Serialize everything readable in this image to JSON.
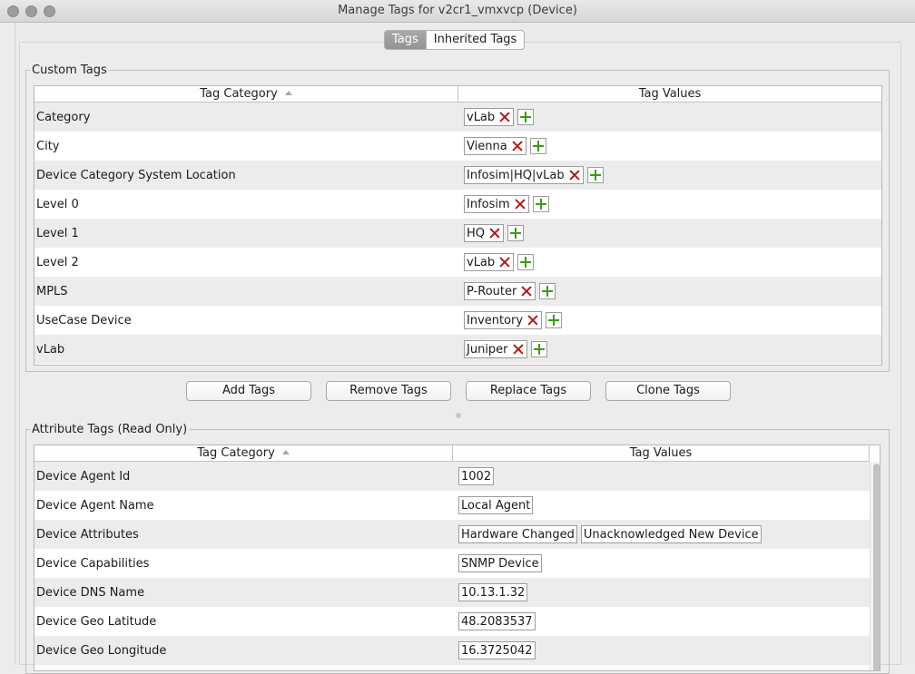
{
  "window": {
    "title": "Manage Tags for v2cr1_vmxvcp (Device)"
  },
  "tabs": [
    {
      "label": "Tags",
      "active": true
    },
    {
      "label": "Inherited Tags",
      "active": false
    }
  ],
  "custom_tags": {
    "title": "Custom Tags",
    "col_category": "Tag Category",
    "col_values": "Tag Values",
    "rows": [
      {
        "category": "Category",
        "value": "vLab"
      },
      {
        "category": "City",
        "value": "Vienna"
      },
      {
        "category": "Device Category System Location",
        "value": "Infosim|HQ|vLab"
      },
      {
        "category": "Level 0",
        "value": "Infosim"
      },
      {
        "category": "Level 1",
        "value": "HQ"
      },
      {
        "category": "Level 2",
        "value": "vLab"
      },
      {
        "category": "MPLS",
        "value": "P-Router"
      },
      {
        "category": "UseCase Device",
        "value": "Inventory"
      },
      {
        "category": "vLab",
        "value": "Juniper"
      }
    ]
  },
  "buttons": {
    "add": "Add Tags",
    "remove": "Remove Tags",
    "replace": "Replace Tags",
    "clone": "Clone Tags"
  },
  "attribute_tags": {
    "title": "Attribute Tags (Read Only)",
    "col_category": "Tag Category",
    "col_values": "Tag Values",
    "rows": [
      {
        "category": "Device Agent Id",
        "values": [
          "1002"
        ]
      },
      {
        "category": "Device Agent Name",
        "values": [
          "Local Agent"
        ]
      },
      {
        "category": "Device Attributes",
        "values": [
          "Hardware Changed",
          "Unacknowledged New Device"
        ]
      },
      {
        "category": "Device Capabilities",
        "values": [
          "SNMP Device"
        ]
      },
      {
        "category": "Device DNS Name",
        "values": [
          "10.13.1.32"
        ]
      },
      {
        "category": "Device Geo Latitude",
        "values": [
          "48.2083537"
        ]
      },
      {
        "category": "Device Geo Longitude",
        "values": [
          "16.3725042"
        ]
      }
    ]
  },
  "colors": {
    "remove_x": "#b01818",
    "add_plus": "#3a9a1a",
    "active_tab": "#9e9e9e"
  },
  "icons": {
    "remove": "close-icon",
    "add": "plus-icon"
  }
}
